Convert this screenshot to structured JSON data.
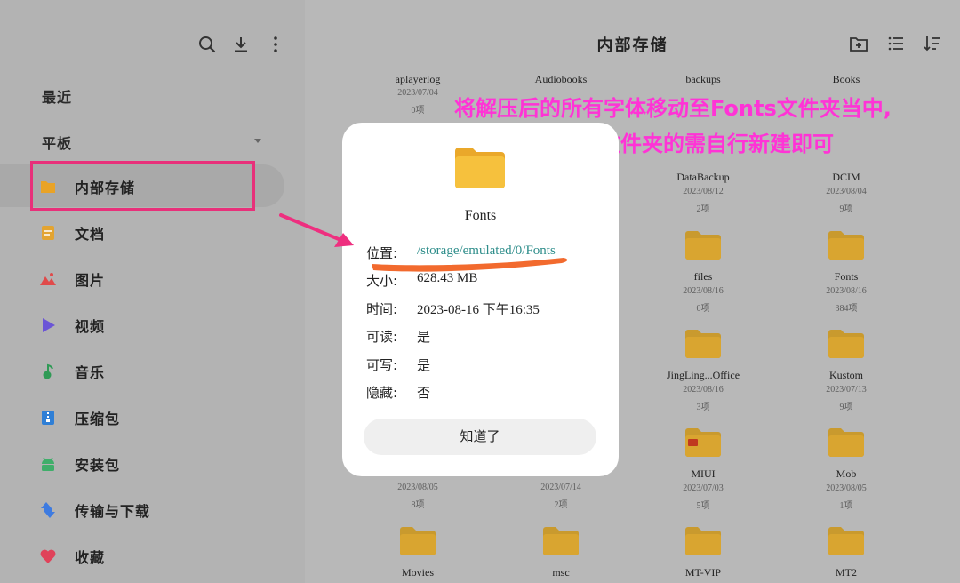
{
  "sidebar": {
    "recent": "最近",
    "tablet": "平板",
    "items": [
      {
        "label": "内部存储",
        "icon": "folder-icon",
        "color": "#e9a327"
      },
      {
        "label": "文档",
        "icon": "document-icon",
        "color": "#e3a431"
      },
      {
        "label": "图片",
        "icon": "image-icon",
        "color": "#e04a4a"
      },
      {
        "label": "视频",
        "icon": "play-icon",
        "color": "#6b55d6"
      },
      {
        "label": "音乐",
        "icon": "music-icon",
        "color": "#2f9a55"
      },
      {
        "label": "压缩包",
        "icon": "archive-icon",
        "color": "#2f7fd6"
      },
      {
        "label": "安装包",
        "icon": "android-icon",
        "color": "#3fae6a"
      },
      {
        "label": "传输与下载",
        "icon": "transfer-icon",
        "color": "#3e7be0"
      },
      {
        "label": "收藏",
        "icon": "heart-icon",
        "color": "#e0425a"
      }
    ]
  },
  "header": {
    "title": "内部存储"
  },
  "files": [
    {
      "name": "aplayerlog",
      "date": "2023/07/04",
      "count": "0项"
    },
    {
      "name": "Audiobooks",
      "date": "",
      "count": ""
    },
    {
      "name": "backups",
      "date": "",
      "count": ""
    },
    {
      "name": "Books",
      "date": "",
      "count": ""
    },
    {
      "name": "DataBackup",
      "date": "2023/08/12",
      "count": "2项"
    },
    {
      "name": "DCIM",
      "date": "2023/08/04",
      "count": "9项"
    },
    {
      "name": "files",
      "date": "2023/08/16",
      "count": "0项"
    },
    {
      "name": "Fonts",
      "date": "2023/08/16",
      "count": "384项"
    },
    {
      "name": "JingLing...Office",
      "date": "2023/08/16",
      "count": "3项"
    },
    {
      "name": "Kustom",
      "date": "2023/07/13",
      "count": "9项"
    },
    {
      "name": "",
      "date": "2023/08/05",
      "count": "8项"
    },
    {
      "name": "",
      "date": "2023/07/14",
      "count": "2项"
    },
    {
      "name": "MIUI",
      "date": "2023/07/03",
      "count": "5项"
    },
    {
      "name": "Mob",
      "date": "2023/08/05",
      "count": "1项"
    },
    {
      "name": "Movies",
      "date": "",
      "count": ""
    },
    {
      "name": "msc",
      "date": "",
      "count": ""
    },
    {
      "name": "MT-VIP",
      "date": "",
      "count": ""
    },
    {
      "name": "MT2",
      "date": "",
      "count": ""
    }
  ],
  "annotation": {
    "line1": "将解压后的所有字体移动至Fonts文件夹当中,",
    "line2": "没有此文件夹的需自行新建即可",
    "color": "#ff33d6"
  },
  "dialog": {
    "folder_name": "Fonts",
    "rows": [
      {
        "key": "位置:",
        "value": "/storage/emulated/0/Fonts"
      },
      {
        "key": "大小:",
        "value": "628.43 MB"
      },
      {
        "key": "时间:",
        "value": "2023-08-16 下午16:35"
      },
      {
        "key": "可读:",
        "value": "是"
      },
      {
        "key": "可写:",
        "value": "是"
      },
      {
        "key": "隐藏:",
        "value": "否"
      }
    ],
    "ok_label": "知道了"
  },
  "colors": {
    "folder": "#f0b429",
    "link": "#2d8d8a",
    "highlight": "#e8307a",
    "underline": "#f26a2e"
  }
}
